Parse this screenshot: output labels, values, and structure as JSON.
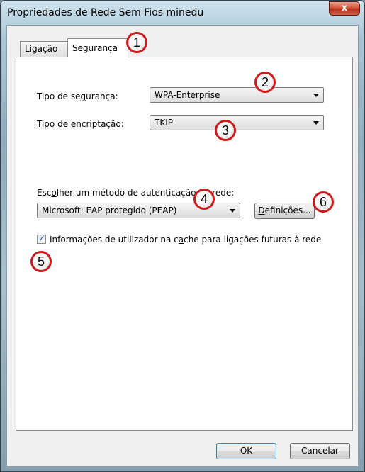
{
  "window": {
    "title": "Propriedades de Rede Sem Fios minedu",
    "close_glyph": "x"
  },
  "tabs": [
    {
      "label": "Ligação"
    },
    {
      "label": "Segurança"
    }
  ],
  "security": {
    "type_label_pre": "Tipo de se",
    "type_label_ul": "g",
    "type_label_post": "urança:",
    "type_value": "WPA-Enterprise",
    "encryption_label_ul": "T",
    "encryption_label_post": "ipo de encriptação:",
    "encryption_value": "TKIP",
    "auth_label_pre": "Esc",
    "auth_label_ul": "o",
    "auth_label_post": "lher um método de autenticação de rede:",
    "auth_value": "Microsoft: EAP protegido (PEAP)",
    "settings_button_ul": "D",
    "settings_button_post": "efinições...",
    "cache_label_pre": "Informações de utilizador na c",
    "cache_label_ul": "a",
    "cache_label_post": "che para ligações futuras à rede",
    "cache_checked": true,
    "check_glyph": "✓"
  },
  "buttons": {
    "ok": "OK",
    "cancel": "Cancelar"
  },
  "markers": [
    "1",
    "2",
    "3",
    "4",
    "5",
    "6"
  ]
}
